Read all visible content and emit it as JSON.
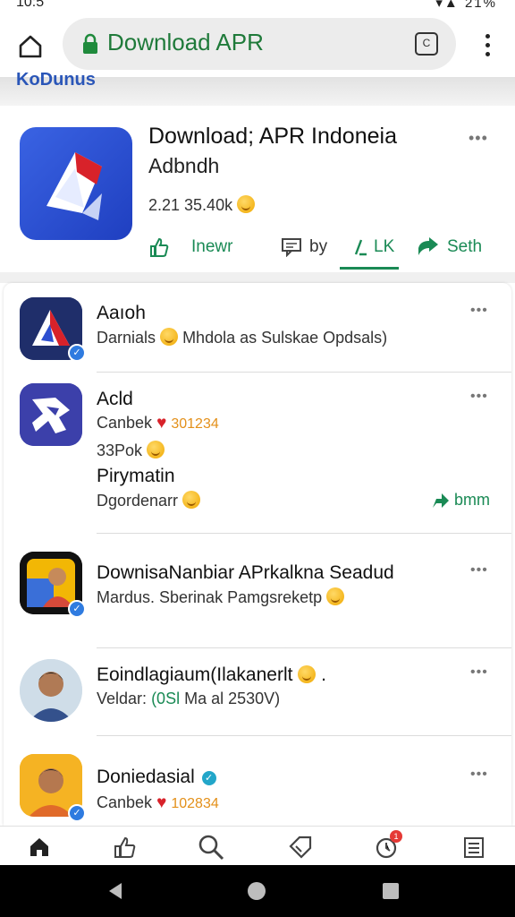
{
  "status_bar": {
    "time": "10:5",
    "battery": "21%"
  },
  "browser": {
    "url_text": "Download APR",
    "tab_count": "C"
  },
  "section_label": "KoDunus",
  "app": {
    "title": "Download; APR Indoneia",
    "subtitle": "Adbndh",
    "stats": "2.21 35.40k",
    "actions": [
      {
        "label": "Inewr",
        "icon": "thumbs-up-icon"
      },
      {
        "label": "by",
        "icon": "chat-icon"
      },
      {
        "label": "LK",
        "icon": "chart-icon"
      },
      {
        "label": "Seth",
        "icon": "share-icon"
      }
    ]
  },
  "list": [
    {
      "title": "Aaıoh",
      "subtitle": "Darnials",
      "subtitle_rest": "Mhdola as Sulskae Opdsals)"
    },
    {
      "title": "Acld",
      "line1_label": "Canbek",
      "line1_num": "301234",
      "line2": "33Pok",
      "title2": "Pirymatin",
      "line3": "Dgordenarr",
      "follow_label": "bmm"
    },
    {
      "title": "DownisaNanbiar APrkalkna Seadud",
      "subtitle": "Mardus. Sberinak Pamgsreketp"
    },
    {
      "title": "Eoindlagiaum(Ilakanerlt",
      "subtitle_pre": "Veldar:",
      "subtitle_mid": "(0Sl",
      "subtitle_post": "Ma al 2530V)"
    },
    {
      "title": "Doniedasial",
      "subtitle": "Canbek",
      "num": "102834"
    }
  ],
  "colors": {
    "accent_green": "#1a8a55",
    "url_green": "#1f7a3a",
    "link_blue": "#2a56b8",
    "orange": "#e3901a",
    "heart_red": "#d8222a"
  },
  "bottom_nav": [
    "home-icon",
    "like-icon",
    "search-icon",
    "tag-icon",
    "notification-icon",
    "menu-icon"
  ],
  "notification_badge": "1"
}
